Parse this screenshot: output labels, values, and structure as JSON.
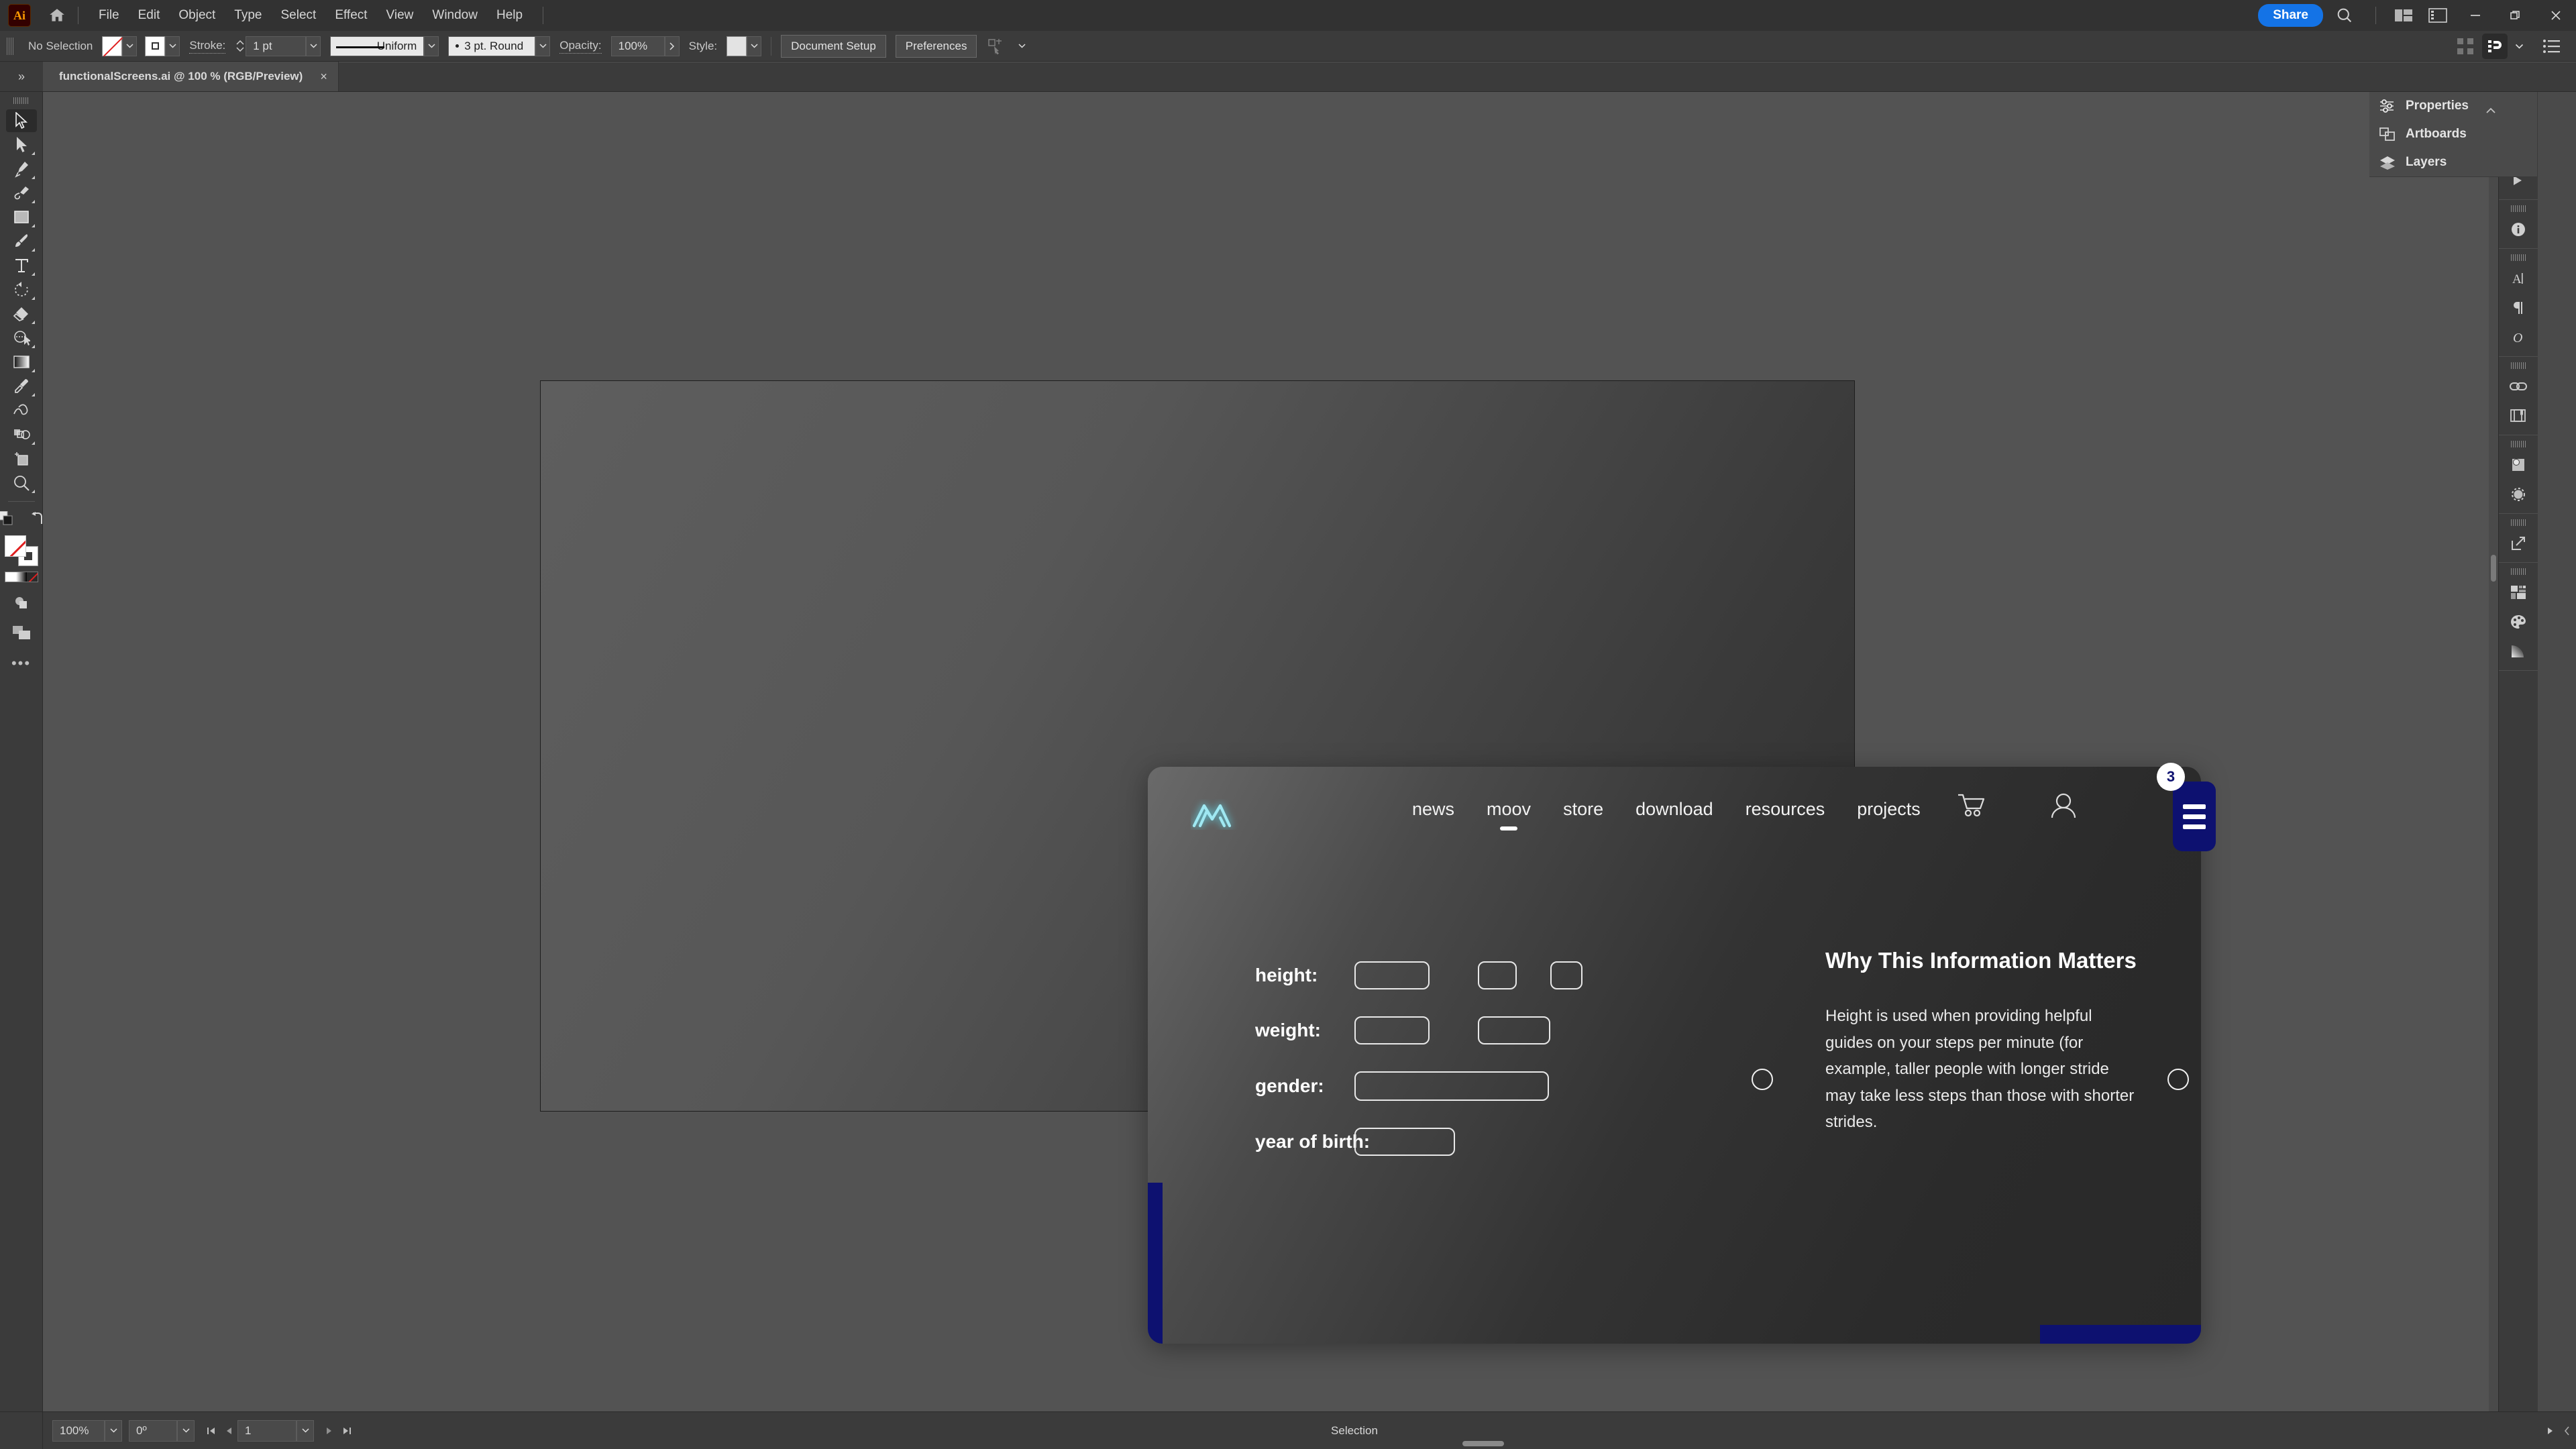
{
  "app": {
    "name": "Adobe Illustrator",
    "logo_text": "Ai"
  },
  "menubar": {
    "items": [
      "File",
      "Edit",
      "Object",
      "Type",
      "Select",
      "Effect",
      "View",
      "Window",
      "Help"
    ],
    "share_label": "Share",
    "icons": [
      "home-icon",
      "search-icon",
      "workspace-switcher-icon",
      "panel-toggle-icon"
    ],
    "window_controls": [
      "minimize",
      "restore",
      "close"
    ]
  },
  "controlbar": {
    "selection_status": "No Selection",
    "fill_label": "fill-swatch",
    "stroke_swatch_label": "stroke-swatch",
    "stroke_label": "Stroke:",
    "stroke_weight": "1 pt",
    "stroke_profile": "Uniform",
    "brush_definition": "3 pt. Round",
    "opacity_label": "Opacity:",
    "opacity_value": "100%",
    "style_label": "Style:",
    "document_setup_label": "Document Setup",
    "preferences_label": "Preferences"
  },
  "tabbar": {
    "document_title": "functionalScreens.ai @ 100 % (RGB/Preview)",
    "close_glyph": "×",
    "collapse_glyph": "»"
  },
  "toolbar": {
    "tools": [
      {
        "name": "selection-tool",
        "active": true
      },
      {
        "name": "direct-selection-tool",
        "active": false
      },
      {
        "name": "pen-tool",
        "active": false
      },
      {
        "name": "curvature-tool",
        "active": false
      },
      {
        "name": "rectangle-tool",
        "active": false
      },
      {
        "name": "paintbrush-tool",
        "active": false
      },
      {
        "name": "type-tool",
        "active": false
      },
      {
        "name": "rotate-tool",
        "active": false
      },
      {
        "name": "eraser-tool",
        "active": false
      },
      {
        "name": "shape-builder-tool",
        "active": false
      },
      {
        "name": "gradient-tool",
        "active": false
      },
      {
        "name": "eyedropper-tool",
        "active": false
      },
      {
        "name": "blend-tool",
        "active": false
      },
      {
        "name": "symbol-sprayer-tool",
        "active": false
      },
      {
        "name": "artboard-tool",
        "active": false
      },
      {
        "name": "zoom-tool",
        "active": false
      }
    ],
    "edit_toolbar_glyph": "•••"
  },
  "right_dock": {
    "panels": [
      {
        "label": "Properties",
        "icon": "sliders-icon"
      },
      {
        "label": "Artboards",
        "icon": "artboards-icon"
      },
      {
        "label": "Layers",
        "icon": "layers-icon"
      }
    ],
    "rail_icons": [
      "properties-icon",
      "artboards-icon",
      "layers-icon",
      "info-icon",
      "character-icon",
      "paragraph-icon",
      "glyphs-icon",
      "links-icon",
      "libraries-icon",
      "pathfinder-icon",
      "transparency-icon",
      "asset-export-icon",
      "swatches-icon",
      "color-icon",
      "gradient-icon"
    ]
  },
  "statusbar": {
    "zoom": "100%",
    "rotation": "0º",
    "artboard_number": "1",
    "status_text": "Selection"
  },
  "mockup": {
    "brand": {
      "logo": "moov-m-logo",
      "color": "#9fe8f2"
    },
    "nav": {
      "links": [
        {
          "label": "news",
          "active": false
        },
        {
          "label": "moov",
          "active": true
        },
        {
          "label": "store",
          "active": false
        },
        {
          "label": "download",
          "active": false
        },
        {
          "label": "resources",
          "active": false
        },
        {
          "label": "projects",
          "active": false
        }
      ],
      "cart_icon": "cart-icon",
      "account_icon": "user-icon",
      "cart_badge": "3",
      "menu_icon": "hamburger-icon",
      "accent_color": "#0d1170"
    },
    "form": {
      "fields": [
        {
          "label": "height:",
          "inputs": 3
        },
        {
          "label": "weight:",
          "inputs": 2
        },
        {
          "label": "gender:",
          "inputs": 1
        },
        {
          "label": "year of birth:",
          "inputs": 1
        }
      ]
    },
    "info": {
      "title": "Why This Information Matters",
      "body": "Height is used when providing helpful guides on your steps per minute (for example, taller people with longer stride may take less steps than those with shorter strides.",
      "left_marker": "carousel-dot-left",
      "right_marker": "carousel-dot-right"
    }
  }
}
